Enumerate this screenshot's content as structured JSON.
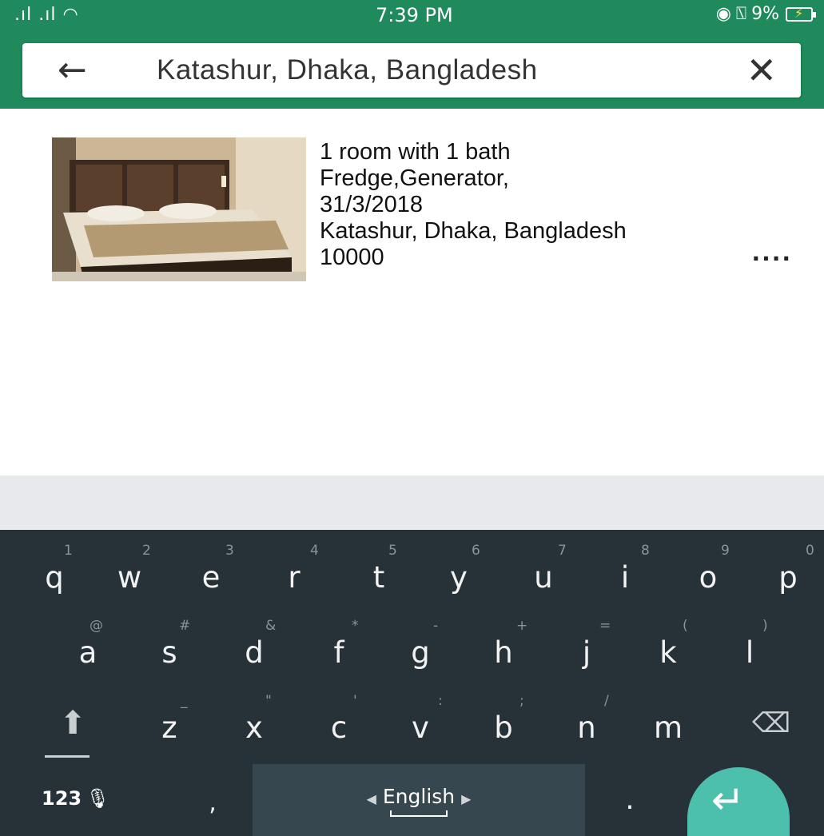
{
  "status_bar": {
    "signal": ".ıl .ıl",
    "time": "7:39 PM",
    "battery": "9%"
  },
  "search": {
    "query": "Katashur, Dhaka, Bangladesh"
  },
  "listing": {
    "line1": "1 room with 1 bath",
    "line2": "Fredge,Generator,",
    "line3": "31/3/2018",
    "line4": "Katashur, Dhaka, Bangladesh",
    "line5": "10000",
    "more": "...."
  },
  "keyboard": {
    "row1": [
      {
        "key": "q",
        "hint": "1"
      },
      {
        "key": "w",
        "hint": "2"
      },
      {
        "key": "e",
        "hint": "3"
      },
      {
        "key": "r",
        "hint": "4"
      },
      {
        "key": "t",
        "hint": "5"
      },
      {
        "key": "y",
        "hint": "6"
      },
      {
        "key": "u",
        "hint": "7"
      },
      {
        "key": "i",
        "hint": "8"
      },
      {
        "key": "o",
        "hint": "9"
      },
      {
        "key": "p",
        "hint": "0"
      }
    ],
    "row2": [
      {
        "key": "a",
        "hint": "@"
      },
      {
        "key": "s",
        "hint": "#"
      },
      {
        "key": "d",
        "hint": "&"
      },
      {
        "key": "f",
        "hint": "*"
      },
      {
        "key": "g",
        "hint": "-"
      },
      {
        "key": "h",
        "hint": "+"
      },
      {
        "key": "j",
        "hint": "="
      },
      {
        "key": "k",
        "hint": "("
      },
      {
        "key": "l",
        "hint": ")"
      }
    ],
    "row3": [
      {
        "key": "z",
        "hint": "_"
      },
      {
        "key": "x",
        "hint": "\""
      },
      {
        "key": "c",
        "hint": "'"
      },
      {
        "key": "v",
        "hint": ":"
      },
      {
        "key": "b",
        "hint": ";"
      },
      {
        "key": "n",
        "hint": "/"
      },
      {
        "key": "m",
        "hint": ""
      }
    ],
    "numbers_label": "123",
    "comma": ",",
    "period": ".",
    "language": "English"
  }
}
